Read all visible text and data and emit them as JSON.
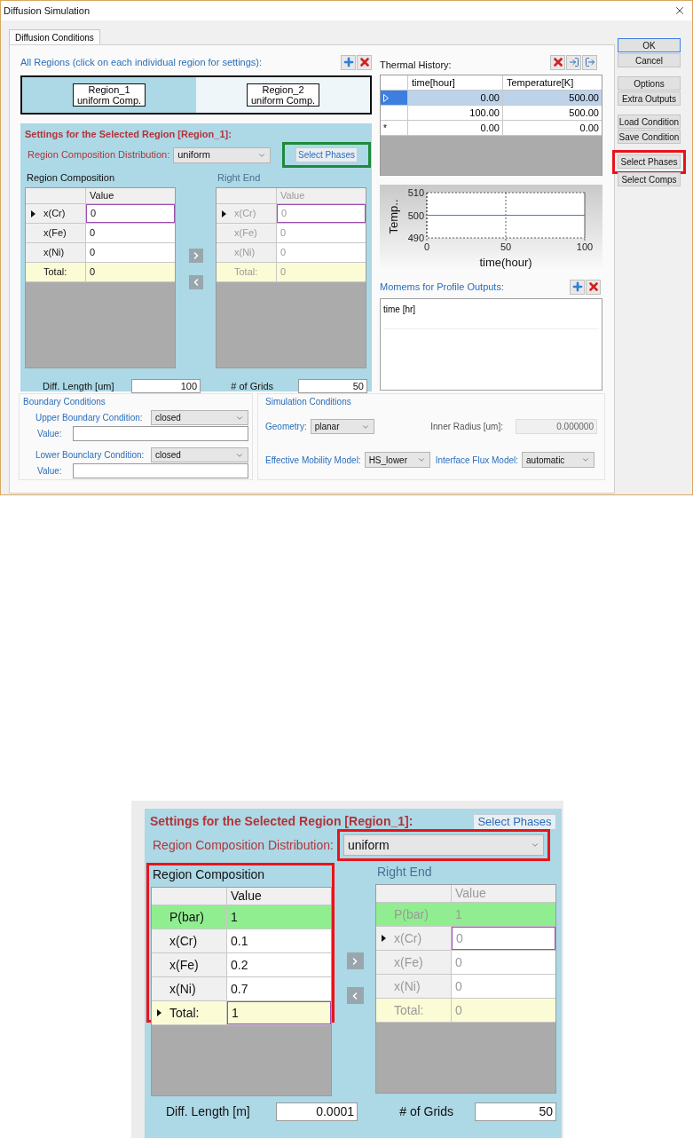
{
  "window": {
    "title": "Diffusion Simulation"
  },
  "tabs": [
    {
      "label": "Diffusion Conditions",
      "selected": true
    }
  ],
  "regions": {
    "label": "All Regions (click on each individual region for settings):",
    "items": [
      {
        "name": "Region_1",
        "type": "uniform Comp.",
        "selected": true
      },
      {
        "name": "Region_2",
        "type": "uniform Comp.",
        "selected": false
      }
    ]
  },
  "settings": {
    "title": "Settings for the Selected Region [Region_1]:",
    "select_phases": {
      "label": "Select Phases",
      "highlight": {
        "color": "#1d8a3a"
      }
    },
    "distribution": {
      "label": "Region Composition Distribution:",
      "value": "uniform"
    },
    "composition": {
      "label": "Region Composition",
      "column": "Value",
      "rows": [
        {
          "label": "x(Cr)",
          "value": "0",
          "kind": "normal",
          "current": true
        },
        {
          "label": "x(Fe)",
          "value": "0",
          "kind": "normal",
          "current": false
        },
        {
          "label": "x(Ni)",
          "value": "0",
          "kind": "normal",
          "current": false
        },
        {
          "label": "Total:",
          "value": "0",
          "kind": "total",
          "current": false
        }
      ]
    },
    "right_end": {
      "label": "Right End",
      "column": "Value",
      "rows": [
        {
          "label": "x(Cr)",
          "value": "0",
          "kind": "normal",
          "current": true
        },
        {
          "label": "x(Fe)",
          "value": "0",
          "kind": "normal",
          "current": false
        },
        {
          "label": "x(Ni)",
          "value": "0",
          "kind": "normal",
          "current": false
        },
        {
          "label": "Total:",
          "value": "0",
          "kind": "total",
          "current": false
        }
      ]
    },
    "diff_length": {
      "label": "Diff. Length [um]",
      "value": "100"
    },
    "grids": {
      "label": "# of Grids",
      "value": "50"
    }
  },
  "thermal_history": {
    "label": "Thermal History:",
    "columns": [
      "time[hour]",
      "Temperature[K]"
    ],
    "rows": [
      {
        "time": "0.00",
        "temperature": "500.00",
        "selected": true
      },
      {
        "time": "100.00",
        "temperature": "500.00",
        "selected": false
      },
      {
        "marker": "*",
        "time": "0.00",
        "temperature": "0.00",
        "selected": false
      }
    ],
    "chart_data": {
      "type": "line",
      "xlabel": "time(hour)",
      "ylabel": "Temp..",
      "x": [
        0,
        100
      ],
      "series": [
        {
          "color": "#3c7fe0",
          "values": [
            500,
            500
          ]
        }
      ],
      "xlim": [
        0,
        100
      ],
      "ylim": [
        490,
        510
      ],
      "xticks": [
        0,
        50,
        100
      ],
      "yticks": [
        490,
        500,
        510
      ]
    }
  },
  "outputs": {
    "label": "Momems for Profile Outputs:",
    "items": [
      "time [hr]"
    ]
  },
  "boundary": {
    "title": "Boundary Conditions",
    "rows": [
      {
        "label": "Upper Boundary Condition:",
        "value": "closed",
        "value_label": "Value:"
      },
      {
        "label": "Lower Bounclary Condition:",
        "value": "closed",
        "value_label": "Value:"
      }
    ]
  },
  "simulation": {
    "title": "Simulation Conditions",
    "geometry": {
      "label": "Geometry:",
      "value": "planar"
    },
    "inner_radius": {
      "label": "Inner Radius [um]:",
      "value": "0.000000"
    },
    "mobility": {
      "label": "Effective Mobility Model:",
      "value": "HS_lower"
    },
    "flux": {
      "label": "Interface Flux Model:",
      "value": "automatic"
    }
  },
  "buttons": [
    [
      {
        "label": "OK",
        "default": true
      },
      {
        "label": "Cancel",
        "default": false
      }
    ],
    [
      {
        "label": "Options",
        "default": false
      },
      {
        "label": "Extra Outputs",
        "default": false
      }
    ],
    [
      {
        "label": "Load Condition",
        "default": false
      },
      {
        "label": "Save Condition",
        "default": false
      }
    ],
    [
      {
        "label": "Select Phases",
        "default": false,
        "highlight": {
          "color": "#e8141a"
        }
      },
      {
        "label": "Select Comps",
        "default": false
      }
    ]
  ],
  "zoomed_settings": {
    "title": "Settings for the Selected Region [Region_1]:",
    "select_phases": {
      "label": "Select Phases"
    },
    "distribution": {
      "label": "Region Composition Distribution:",
      "value": "uniform",
      "highlight": {
        "color": "#e8141a"
      }
    },
    "composition": {
      "label": "Region Composition",
      "column": "Value",
      "highlight": {
        "color": "#e8141a"
      },
      "rows": [
        {
          "label": "P(bar)",
          "value": "1",
          "kind": "pressure",
          "current": false
        },
        {
          "label": "x(Cr)",
          "value": "0.1",
          "kind": "normal",
          "current": false
        },
        {
          "label": "x(Fe)",
          "value": "0.2",
          "kind": "normal",
          "current": false
        },
        {
          "label": "x(Ni)",
          "value": "0.7",
          "kind": "normal",
          "current": false
        },
        {
          "label": "Total:",
          "value": "1",
          "kind": "total",
          "current": true
        }
      ]
    },
    "right_end": {
      "label": "Right End",
      "column": "Value",
      "rows": [
        {
          "label": "P(bar)",
          "value": "1",
          "kind": "pressure",
          "current": false
        },
        {
          "label": "x(Cr)",
          "value": "0",
          "kind": "normal",
          "current": true
        },
        {
          "label": "x(Fe)",
          "value": "0",
          "kind": "normal",
          "current": false
        },
        {
          "label": "x(Ni)",
          "value": "0",
          "kind": "normal",
          "current": false
        },
        {
          "label": "Total:",
          "value": "0",
          "kind": "total",
          "current": false
        }
      ]
    },
    "diff_length": {
      "label": "Diff. Length [m]",
      "value": "0.0001"
    },
    "grids": {
      "label": "# of Grids",
      "value": "50"
    }
  }
}
